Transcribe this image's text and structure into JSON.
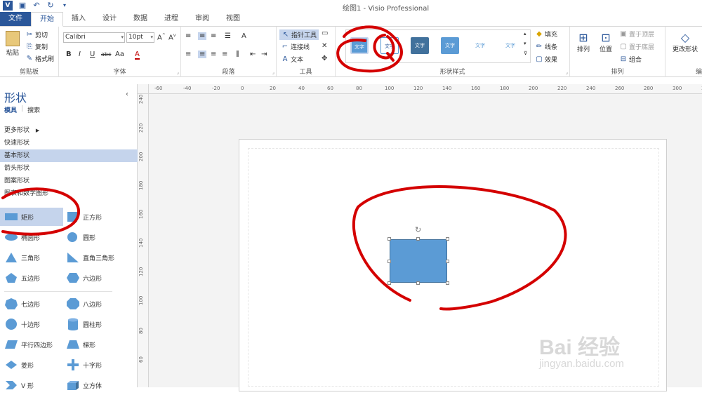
{
  "window": {
    "title": "绘图1 - Visio Professional",
    "app_logo": "V"
  },
  "qat": {
    "save_icon": "save-icon",
    "undo_icon": "undo-icon",
    "redo_icon": "redo-icon"
  },
  "tabs": [
    {
      "label": "文件"
    },
    {
      "label": "开始"
    },
    {
      "label": "插入"
    },
    {
      "label": "设计"
    },
    {
      "label": "数据"
    },
    {
      "label": "进程"
    },
    {
      "label": "审阅"
    },
    {
      "label": "视图"
    }
  ],
  "ribbon": {
    "clipboard": {
      "label": "剪贴板",
      "paste": "粘贴",
      "cut": "剪切",
      "copy": "复制",
      "format_painter": "格式刷"
    },
    "font": {
      "label": "字体",
      "name": "Calibri",
      "size": "10pt",
      "bold": "B",
      "italic": "I",
      "underline": "U",
      "strike": "abc",
      "case": "Aa",
      "color": "A"
    },
    "paragraph": {
      "label": "段落"
    },
    "tools": {
      "label": "工具",
      "pointer": "指针工具",
      "connector": "连接线",
      "text": "文本"
    },
    "shape_styles": {
      "label": "形状样式",
      "sample": "文字",
      "fill": "填充",
      "line": "线条",
      "effects": "效果"
    },
    "arrange": {
      "label": "排列",
      "arrange": "排列",
      "position": "位置",
      "bring_front": "置于顶层",
      "send_back": "置于底层",
      "group": "组合"
    },
    "edit": {
      "label": "编",
      "change_shape": "更改形状"
    }
  },
  "shapes_panel": {
    "title": "形状",
    "tabs": [
      "模具",
      "搜索"
    ],
    "stencils": [
      "更多形状",
      "快速形状",
      "基本形状",
      "箭头形状",
      "图案形状",
      "图表和数学图形"
    ],
    "selected_stencil": "基本形状",
    "shapes": [
      [
        "矩形",
        "正方形"
      ],
      [
        "椭圆形",
        "圆形"
      ],
      [
        "三角形",
        "直角三角形"
      ],
      [
        "五边形",
        "六边形"
      ],
      [
        "七边形",
        "八边形"
      ],
      [
        "十边形",
        "圆柱形"
      ],
      [
        "平行四边形",
        "梯形"
      ],
      [
        "菱形",
        "十字形"
      ],
      [
        "V 形",
        "立方体"
      ]
    ]
  },
  "ruler_h": [
    "-60",
    "-40",
    "-20",
    "0",
    "20",
    "40",
    "60",
    "80",
    "100",
    "120",
    "140",
    "160",
    "180",
    "200",
    "220",
    "240",
    "260",
    "280",
    "300",
    "32"
  ],
  "ruler_v": [
    "240",
    "220",
    "200",
    "180",
    "160",
    "140",
    "120",
    "100",
    "80",
    "60"
  ],
  "watermark": {
    "brand": "Bai 经验",
    "url": "jingyan.baidu.com"
  },
  "colors": {
    "accent": "#2b579a",
    "shape_fill": "#5b9bd5",
    "annotation": "#d40000",
    "selection": "#c5d4ec"
  }
}
